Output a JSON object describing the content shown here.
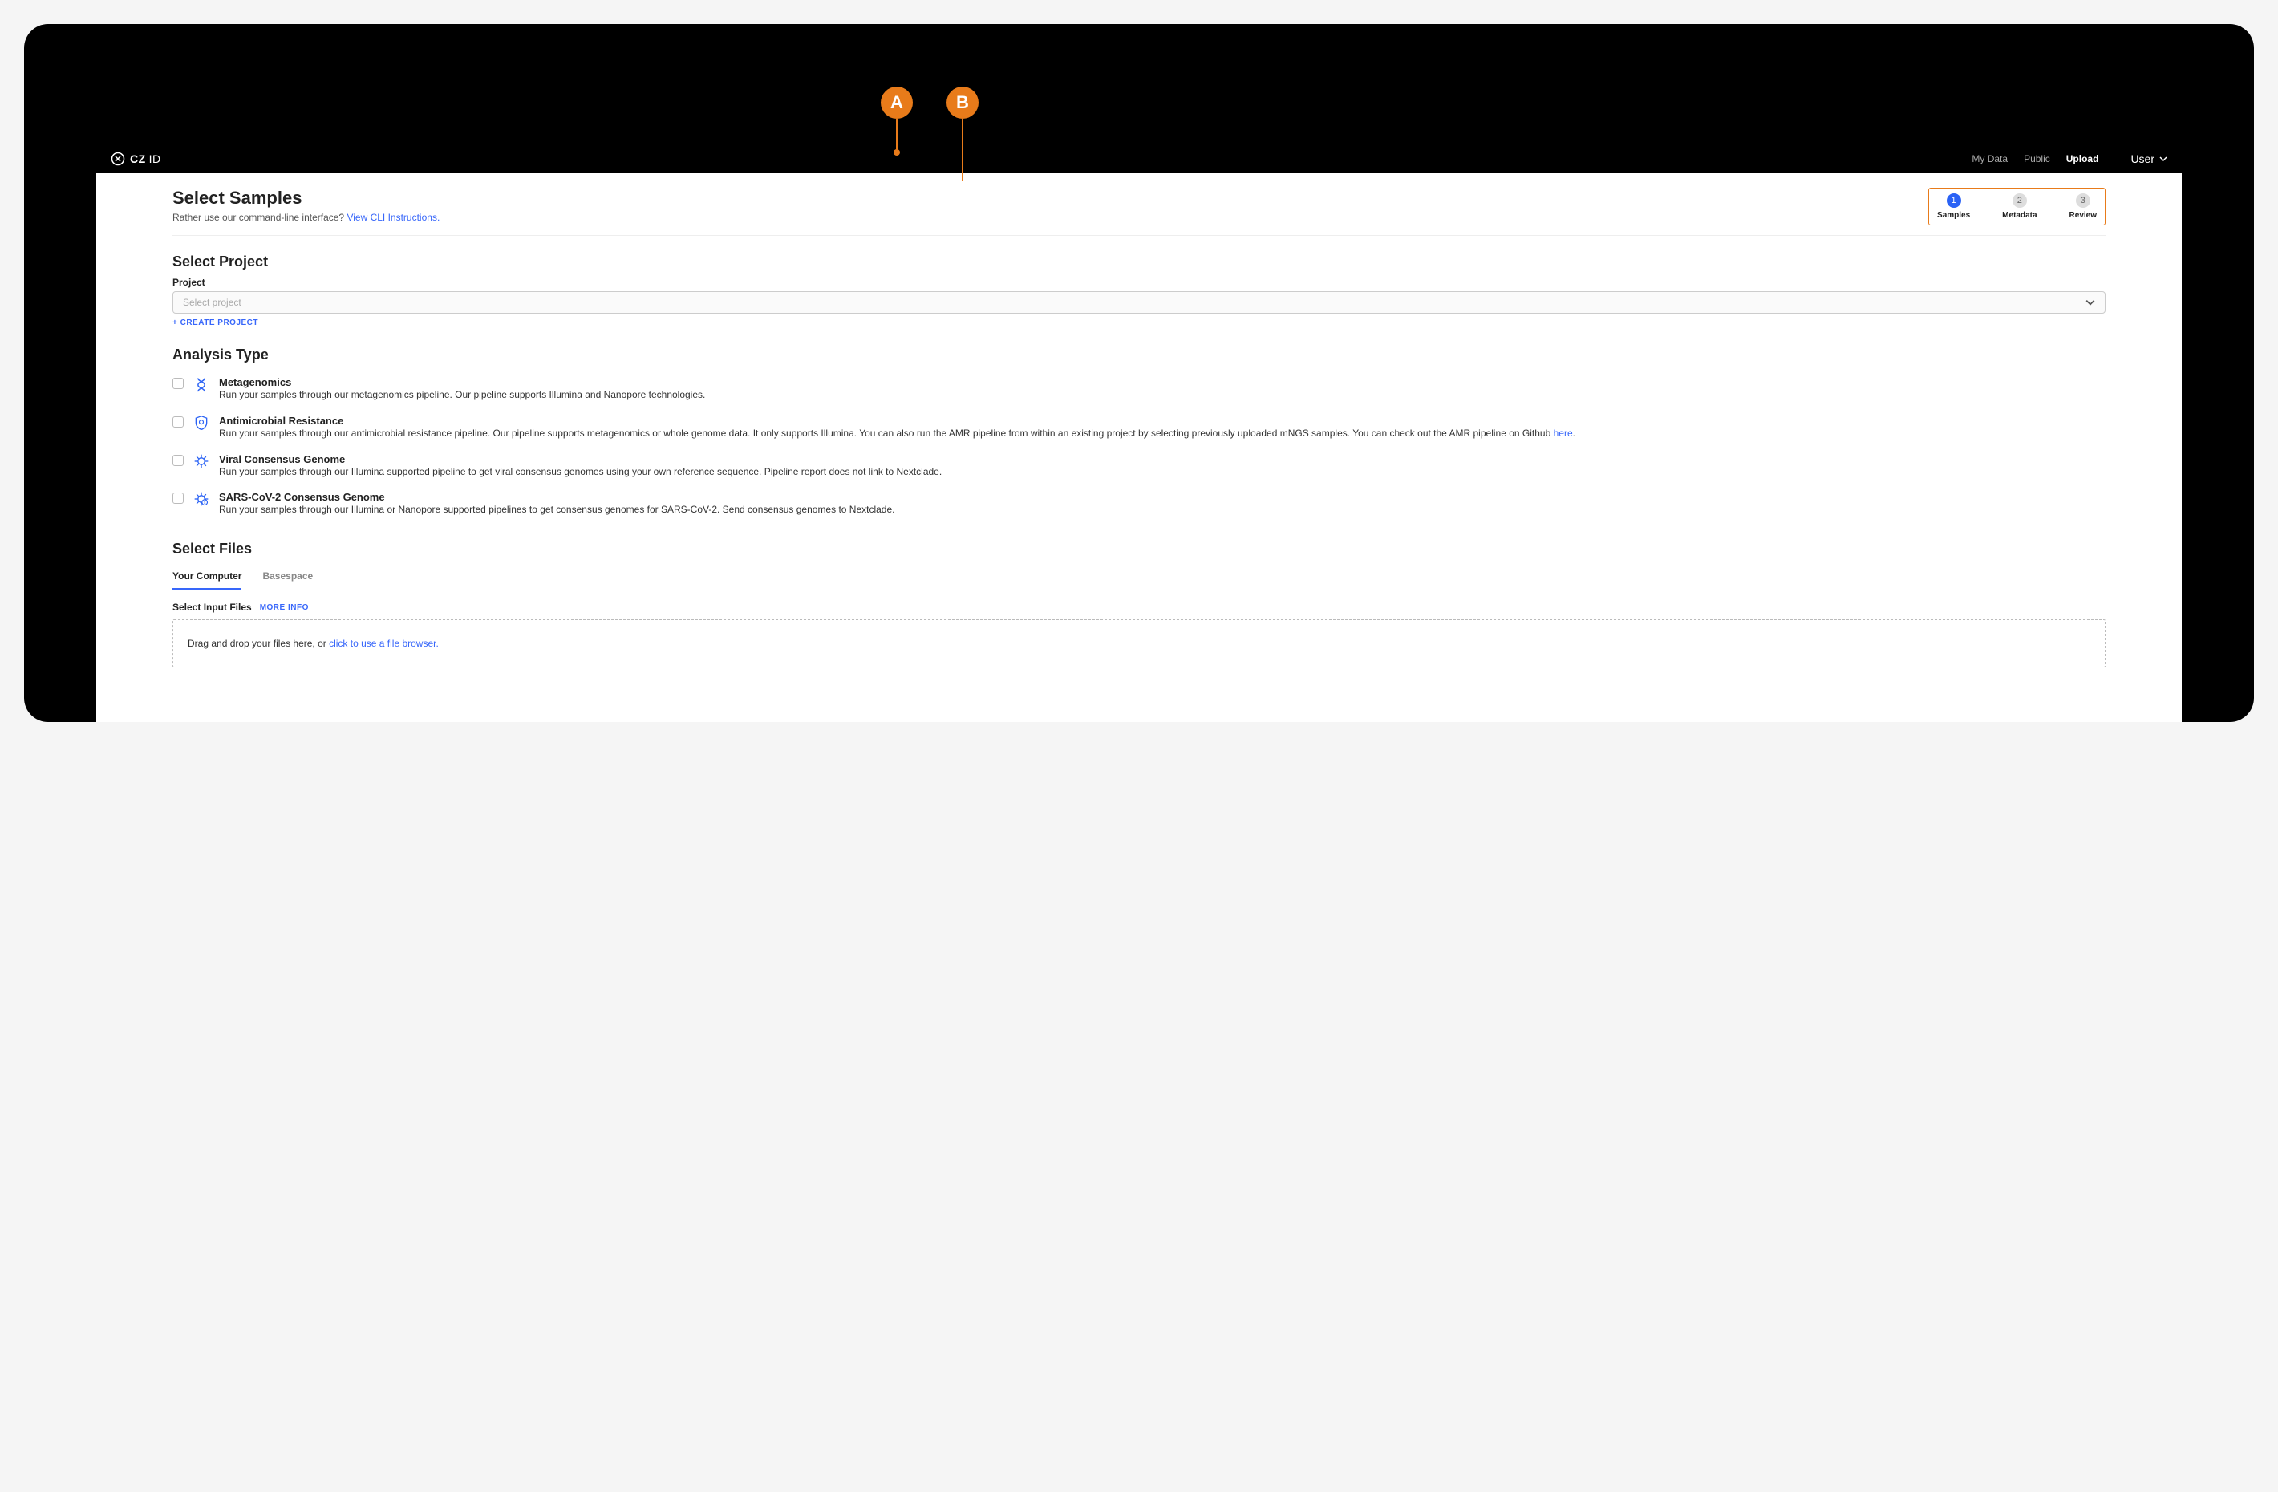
{
  "brand": {
    "cz": "CZ",
    "id": "ID"
  },
  "nav": {
    "mydata": "My Data",
    "public": "Public",
    "upload": "Upload",
    "user": "User"
  },
  "steps": [
    {
      "num": "1",
      "label": "Samples",
      "active": true
    },
    {
      "num": "2",
      "label": "Metadata",
      "active": false
    },
    {
      "num": "3",
      "label": "Review",
      "active": false
    }
  ],
  "headline": {
    "title": "Select Samples",
    "sub_prefix": "Rather use our command-line interface? ",
    "sub_link": "View CLI Instructions."
  },
  "project": {
    "section": "Select Project",
    "label": "Project",
    "placeholder": "Select project",
    "create": "+ CREATE PROJECT"
  },
  "analysis": {
    "section": "Analysis Type",
    "types": [
      {
        "title": "Metagenomics",
        "desc": "Run your samples through our metagenomics pipeline. Our pipeline supports Illumina and Nanopore technologies."
      },
      {
        "title": "Antimicrobial Resistance",
        "desc": "Run your samples through our antimicrobial resistance pipeline. Our pipeline supports metagenomics or whole genome data. It only supports Illumina. You can also run the AMR pipeline from within an existing project by selecting previously uploaded mNGS samples. You can check out the AMR pipeline on Github ",
        "link": "here"
      },
      {
        "title": "Viral Consensus Genome",
        "desc": "Run your samples through our Illumina supported pipeline to get viral consensus genomes using your own reference sequence. Pipeline report does not link to Nextclade."
      },
      {
        "title": "SARS-CoV-2 Consensus Genome",
        "desc": "Run your samples through our Illumina or Nanopore supported pipelines to get consensus genomes for SARS-CoV-2. Send consensus genomes to Nextclade."
      }
    ]
  },
  "files": {
    "section": "Select Files",
    "tabs": {
      "computer": "Your Computer",
      "basespace": "Basespace"
    },
    "input_label": "Select Input Files",
    "more_info": "MORE INFO",
    "dropzone_prefix": "Drag and drop your files here, or ",
    "dropzone_link": "click to use a file browser."
  },
  "annotations": {
    "a": "A",
    "b": "B"
  }
}
